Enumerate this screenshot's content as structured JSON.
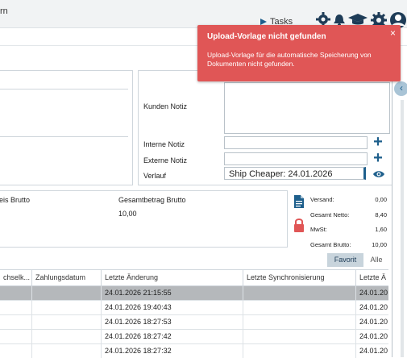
{
  "header": {
    "fragment": "rn",
    "tasks_label": "Tasks",
    "icons": [
      "arrow-right-icon",
      "gear-icon",
      "bell-icon",
      "graduation-cap-icon",
      "settings-gear-icon",
      "user-icon"
    ]
  },
  "notes": {
    "kunden_label": "Kunden Notiz",
    "interne_label": "Interne Notiz",
    "externe_label": "Externe Notiz",
    "verlauf_label": "Verlauf",
    "verlauf_value": "Ship Cheaper: 24.01.2026"
  },
  "brutto": {
    "left_label": "eis Brutto",
    "gesamt_label": "Gesamtbetrag Brutto",
    "gesamt_value": "10,00"
  },
  "summary": {
    "rows": [
      {
        "label": "Versand:",
        "value": "0,00"
      },
      {
        "label": "Gesamt Netto:",
        "value": "8,40"
      },
      {
        "label": "MwSt:",
        "value": "1,60"
      },
      {
        "label": "Gesamt Brutto:",
        "value": "10,00"
      }
    ]
  },
  "tabs": {
    "favorit": "Favorit",
    "alle": "Alle"
  },
  "grid": {
    "headers": [
      "chselk...",
      "Zahlungsdatum",
      "Letzte Änderung",
      "Letzte Synchronisierung",
      "Letzte Ä"
    ],
    "rows": [
      {
        "letzte_aenderung": "24.01.2026 21:15:55",
        "last": "24.01.20"
      },
      {
        "letzte_aenderung": "24.01.2026 19:40:43",
        "last": "24.01.20"
      },
      {
        "letzte_aenderung": "24.01.2026 18:27:53",
        "last": "24.01.20"
      },
      {
        "letzte_aenderung": "24.01.2026 18:27:42",
        "last": "24.01.20"
      },
      {
        "letzte_aenderung": "24.01.2026 18:27:32",
        "last": "24.01.20"
      }
    ]
  },
  "toast": {
    "title": "Upload-Vorlage nicht gefunden",
    "message": "Upload-Vorlage für die automatische Speicherung von Dokumenten nicht gefunden.",
    "close": "×",
    "color": "#e05656"
  },
  "colors": {
    "accent": "#1e5f8c",
    "lock": "#e05656",
    "selected_row": "#b5b8bb"
  }
}
